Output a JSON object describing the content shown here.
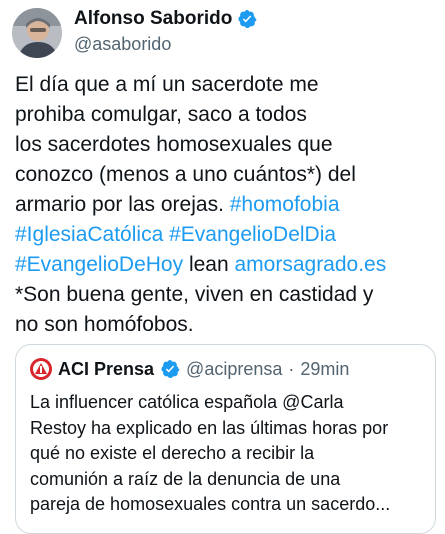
{
  "author": {
    "name": "Alfonso Saborido",
    "handle": "@asaborido",
    "verified_icon": "verified-badge-icon",
    "verified_color": "#1d9bf0"
  },
  "tweet": {
    "lines": [
      [
        {
          "text": "El día que a mí un sacerdote me"
        }
      ],
      [
        {
          "text": "prohiba comulgar, saco a todos"
        }
      ],
      [
        {
          "text": "los sacerdotes homosexuales que"
        }
      ],
      [
        {
          "text": "conozco (menos a uno cuántos*) del"
        }
      ],
      [
        {
          "text": "armario por las orejas. "
        },
        {
          "text": "#homofobia",
          "link": true
        }
      ],
      [
        {
          "text": "#IglesiaCatólica",
          "link": true
        },
        {
          "text": " "
        },
        {
          "text": "#EvangelioDelDia",
          "link": true
        }
      ],
      [
        {
          "text": "#EvangelioDeHoy",
          "link": true
        },
        {
          "text": " lean "
        },
        {
          "text": "amorsagrado.es",
          "link": true
        }
      ],
      [
        {
          "text": "*Son buena gente, viven en castidad y"
        }
      ],
      [
        {
          "text": "no son homófobos."
        }
      ]
    ],
    "link_color": "#1d9bf0"
  },
  "quoted": {
    "name": "ACI Prensa",
    "handle": "@aciprensa",
    "separator": "·",
    "time": "29min",
    "logo_icon": "aci-prensa-logo-icon",
    "lines": [
      "La influencer católica española @Carla",
      "Restoy ha explicado en las últimas horas por",
      "qué no existe el derecho a recibir la",
      "comunión a raíz de la denuncia de una",
      "pareja de homosexuales contra un sacerdo..."
    ]
  }
}
